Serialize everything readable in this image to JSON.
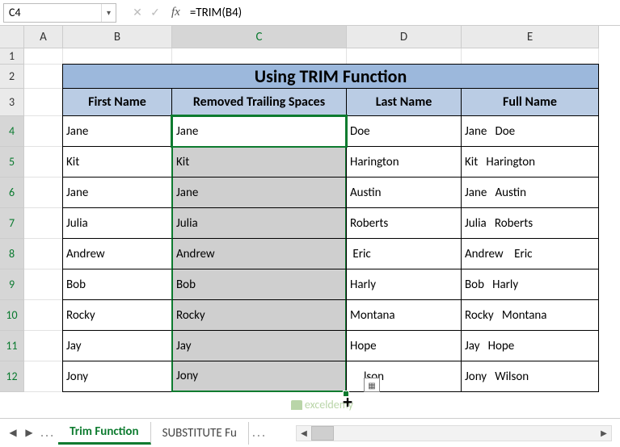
{
  "name_box": "C4",
  "formula": "=TRIM(B4)",
  "columns": [
    "A",
    "B",
    "C",
    "D",
    "E"
  ],
  "rows": [
    "1",
    "2",
    "3",
    "4",
    "5",
    "6",
    "7",
    "8",
    "9",
    "10",
    "11",
    "12"
  ],
  "title": "Using TRIM Function",
  "headers": {
    "first_name": "First Name",
    "removed": "Removed Trailing Spaces",
    "last_name": "Last Name",
    "full_name": "Full Name"
  },
  "data": [
    {
      "first": "Jane",
      "trim": "Jane",
      "last": "Doe",
      "full": "Jane   Doe"
    },
    {
      "first": "Kit",
      "trim": "Kit",
      "last": "Harington",
      "full": "Kit   Harington"
    },
    {
      "first": "Jane",
      "trim": "Jane",
      "last": "Austin",
      "full": "Jane   Austin"
    },
    {
      "first": "Julia",
      "trim": "Julia",
      "last": "Roberts",
      "full": "Julia   Roberts"
    },
    {
      "first": "Andrew",
      "trim": "Andrew",
      "last": " Eric",
      "full": "Andrew    Eric"
    },
    {
      "first": "Bob",
      "trim": "Bob",
      "last": "Harly",
      "full": "Bob   Harly"
    },
    {
      "first": "Rocky",
      "trim": "Rocky",
      "last": "Montana",
      "full": "Rocky   Montana"
    },
    {
      "first": "Jay",
      "trim": "Jay",
      "last": "Hope",
      "full": "Jay   Hope"
    },
    {
      "first": "Jony",
      "trim": "Jony",
      "last": "     lson",
      "full": "Jony   Wilson"
    }
  ],
  "tabs": {
    "active": "Trim Function",
    "next": "SUBSTITUTE Fu",
    "more": "..."
  },
  "watermark": "exceldemy",
  "icons": {
    "dropdown": "▾",
    "cancel": "✕",
    "confirm": "✓",
    "nav_left": "◀",
    "nav_right": "▶",
    "scroll_left": "◀",
    "scroll_right": "▶"
  },
  "chart_data": {
    "type": "table",
    "title": "Using TRIM Function",
    "columns": [
      "First Name",
      "Removed Trailing Spaces",
      "Last Name",
      "Full Name"
    ],
    "rows": [
      [
        "Jane",
        "Jane",
        "Doe",
        "Jane   Doe"
      ],
      [
        "Kit",
        "Kit",
        "Harington",
        "Kit   Harington"
      ],
      [
        "Jane",
        "Jane",
        "Austin",
        "Jane   Austin"
      ],
      [
        "Julia",
        "Julia",
        "Roberts",
        "Julia   Roberts"
      ],
      [
        "Andrew",
        "Andrew",
        " Eric",
        "Andrew    Eric"
      ],
      [
        "Bob",
        "Bob",
        "Harly",
        "Bob   Harly"
      ],
      [
        "Rocky",
        "Rocky",
        "Montana",
        "Rocky   Montana"
      ],
      [
        "Jay",
        "Jay",
        "Hope",
        "Jay   Hope"
      ],
      [
        "Jony",
        "Jony",
        "     lson",
        "Jony   Wilson"
      ]
    ]
  }
}
